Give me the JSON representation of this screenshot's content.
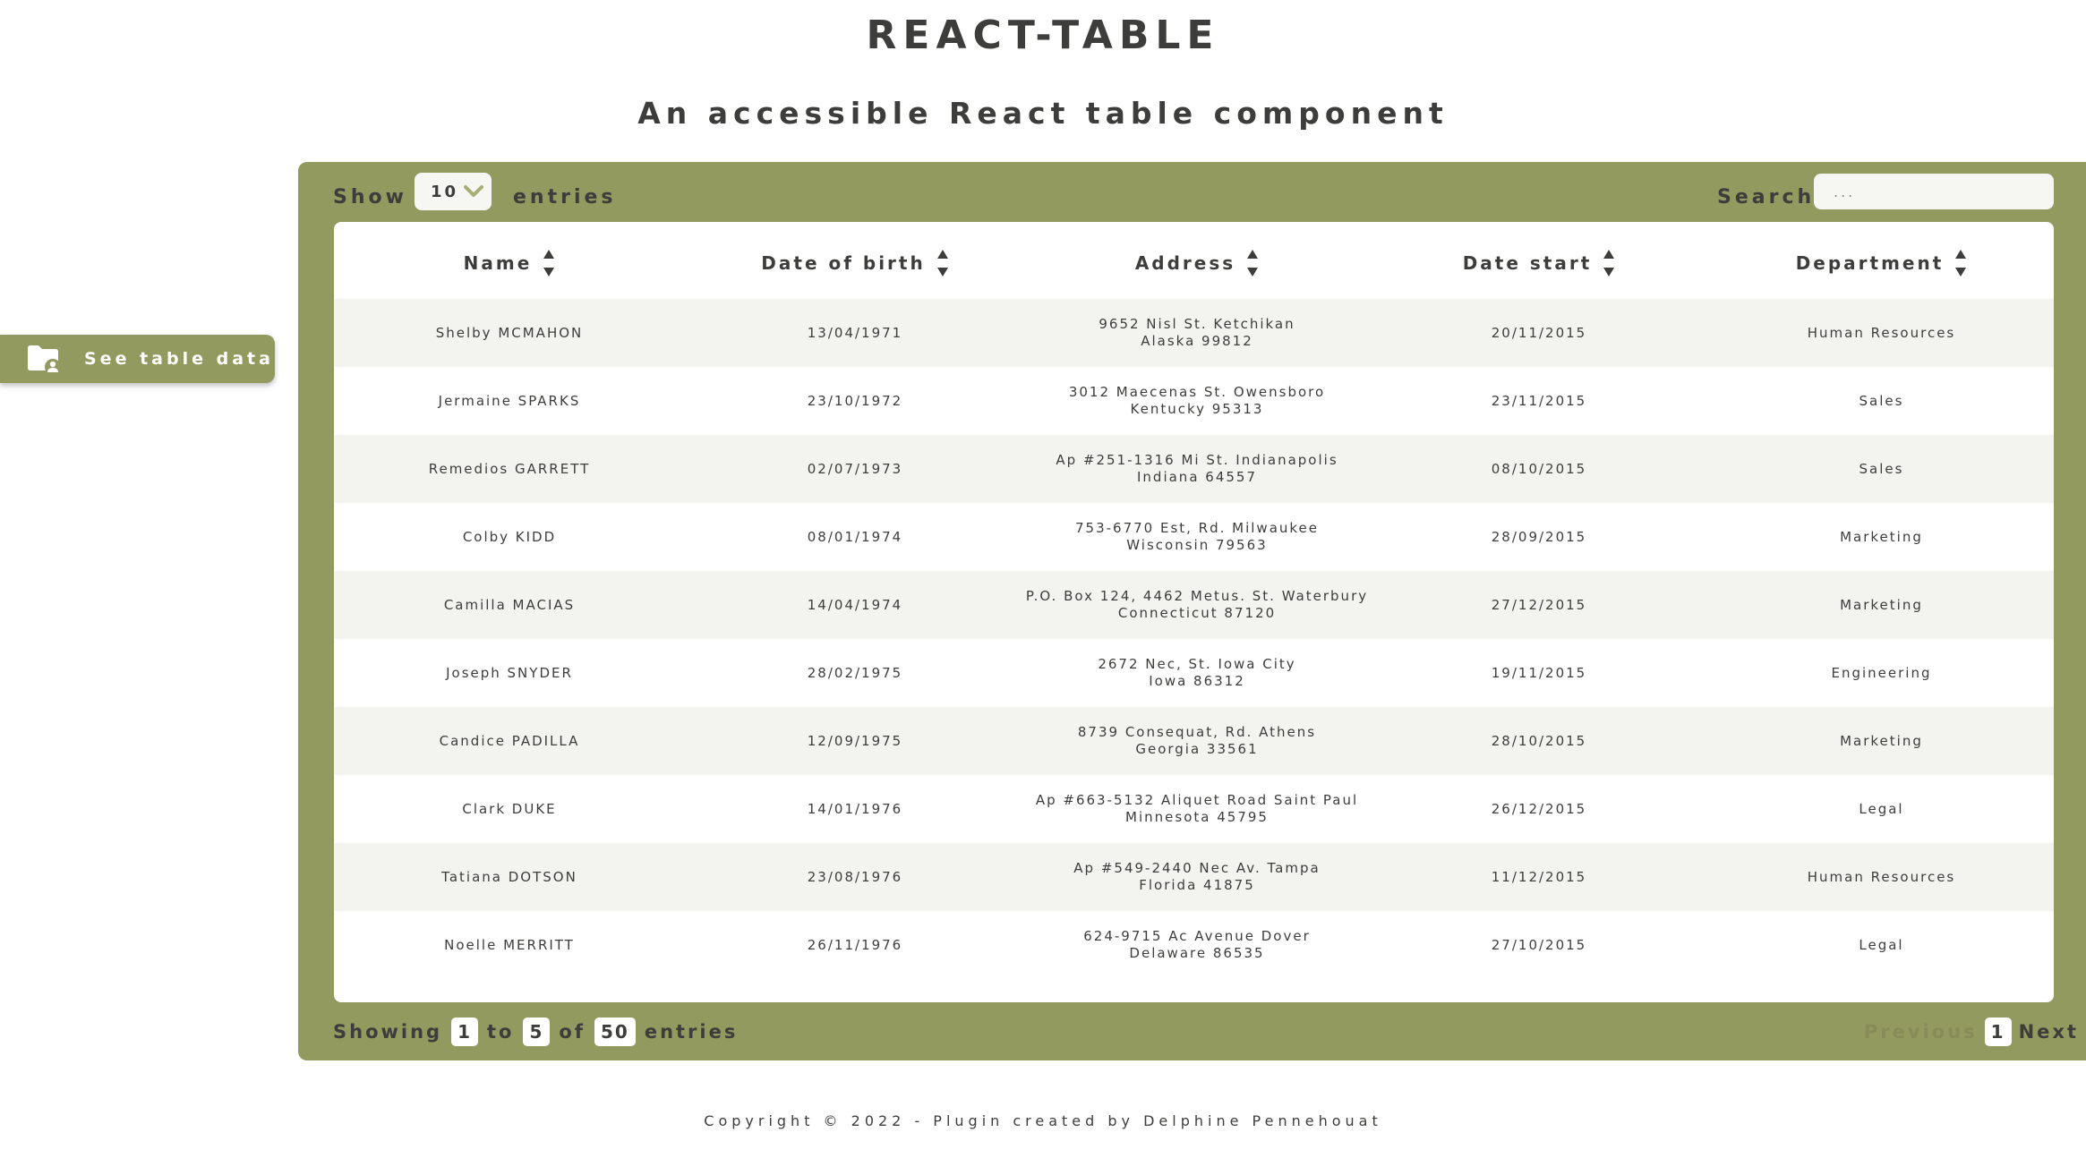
{
  "header": {
    "title": "REACT-TABLE",
    "subtitle": "An accessible React table component"
  },
  "side_button": {
    "label": "See table data",
    "icon": "folder-user-icon"
  },
  "controls": {
    "show_label": "Show",
    "page_size": "10",
    "entries_label": "entries",
    "search_label": "Search",
    "search_placeholder": "..."
  },
  "columns": [
    {
      "label": "Name"
    },
    {
      "label": "Date of birth"
    },
    {
      "label": "Address"
    },
    {
      "label": "Date start"
    },
    {
      "label": "Department"
    }
  ],
  "rows": [
    {
      "name": "Shelby MCMAHON",
      "dob": "13/04/1971",
      "addr1": "9652 Nisl St. Ketchikan",
      "addr2": "Alaska 99812",
      "start": "20/11/2015",
      "dept": "Human Resources"
    },
    {
      "name": "Jermaine SPARKS",
      "dob": "23/10/1972",
      "addr1": "3012 Maecenas St. Owensboro",
      "addr2": "Kentucky 95313",
      "start": "23/11/2015",
      "dept": "Sales"
    },
    {
      "name": "Remedios GARRETT",
      "dob": "02/07/1973",
      "addr1": "Ap #251-1316 Mi St. Indianapolis",
      "addr2": "Indiana 64557",
      "start": "08/10/2015",
      "dept": "Sales"
    },
    {
      "name": "Colby KIDD",
      "dob": "08/01/1974",
      "addr1": "753-6770 Est, Rd. Milwaukee",
      "addr2": "Wisconsin 79563",
      "start": "28/09/2015",
      "dept": "Marketing"
    },
    {
      "name": "Camilla MACIAS",
      "dob": "14/04/1974",
      "addr1": "P.O. Box 124, 4462 Metus. St. Waterbury",
      "addr2": "Connecticut 87120",
      "start": "27/12/2015",
      "dept": "Marketing"
    },
    {
      "name": "Joseph SNYDER",
      "dob": "28/02/1975",
      "addr1": "2672 Nec, St. Iowa City",
      "addr2": "Iowa 86312",
      "start": "19/11/2015",
      "dept": "Engineering"
    },
    {
      "name": "Candice PADILLA",
      "dob": "12/09/1975",
      "addr1": "8739 Consequat, Rd. Athens",
      "addr2": "Georgia 33561",
      "start": "28/10/2015",
      "dept": "Marketing"
    },
    {
      "name": "Clark DUKE",
      "dob": "14/01/1976",
      "addr1": "Ap #663-5132 Aliquet Road Saint Paul",
      "addr2": "Minnesota 45795",
      "start": "26/12/2015",
      "dept": "Legal"
    },
    {
      "name": "Tatiana DOTSON",
      "dob": "23/08/1976",
      "addr1": "Ap #549-2440 Nec Av. Tampa",
      "addr2": "Florida 41875",
      "start": "11/12/2015",
      "dept": "Human Resources"
    },
    {
      "name": "Noelle MERRITT",
      "dob": "26/11/1976",
      "addr1": "624-9715 Ac Avenue Dover",
      "addr2": "Delaware 86535",
      "start": "27/10/2015",
      "dept": "Legal"
    }
  ],
  "footer": {
    "showing_label": "Showing",
    "from": "1",
    "to_label": "to",
    "to": "5",
    "of_label": "of",
    "total": "50",
    "entries_label": "entries"
  },
  "pagination": {
    "previous_label": "Previous",
    "current_page": "1",
    "next_label": "Next"
  },
  "copyright": "Copyright © 2022 - Plugin created by Delphine Pennehouat",
  "colors": {
    "accent": "#939a5f",
    "text": "#3d3d3b",
    "row_alt": "#f3f3ef"
  }
}
